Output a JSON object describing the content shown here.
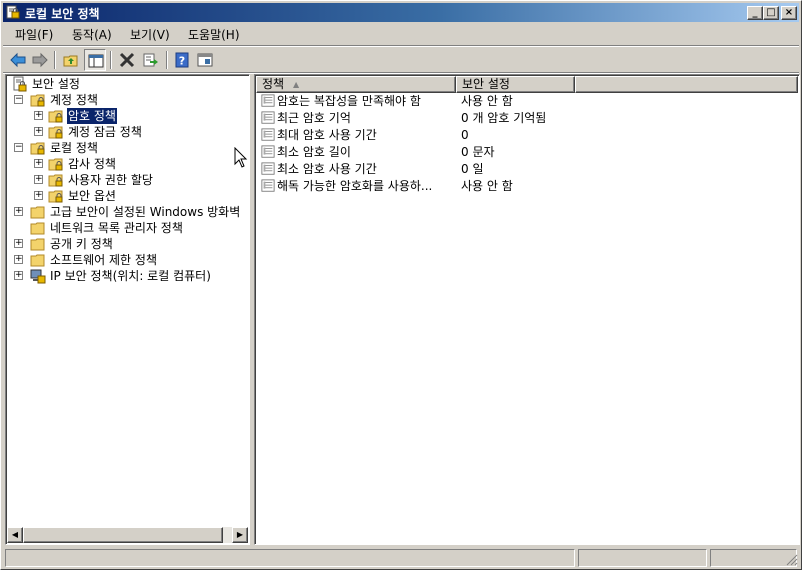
{
  "window": {
    "title": "로컬 보안 정책",
    "buttons": {
      "minimize": "_",
      "maximize": "□",
      "close": "×"
    }
  },
  "menu": [
    "파일(F)",
    "동작(A)",
    "보기(V)",
    "도움말(H)"
  ],
  "toolbar": [
    {
      "name": "back-button",
      "icon": "arrow-left-icon"
    },
    {
      "name": "forward-button",
      "icon": "arrow-right-icon"
    },
    {
      "name": "up-button",
      "icon": "folder-up-icon"
    },
    {
      "name": "show-hide-tree-button",
      "icon": "console-tree-icon"
    },
    {
      "name": "delete-button",
      "icon": "x-icon"
    },
    {
      "name": "export-button",
      "icon": "export-list-icon"
    },
    {
      "name": "help-button",
      "icon": "help-icon"
    },
    {
      "name": "properties-button",
      "icon": "properties-icon"
    }
  ],
  "tree": [
    {
      "label": "보안 설정",
      "expander": "",
      "icon": "security-settings-icon",
      "selected": false
    },
    {
      "label": "계정 정책",
      "expander": "−",
      "icon": "folder-lock-icon",
      "selected": false
    },
    {
      "label": "암호 정책",
      "expander": "+",
      "icon": "folder-lock-icon",
      "selected": true
    },
    {
      "label": "계정 잠금 정책",
      "expander": "+",
      "icon": "folder-lock-icon",
      "selected": false
    },
    {
      "label": "로컬 정책",
      "expander": "−",
      "icon": "folder-lock-icon",
      "selected": false
    },
    {
      "label": "감사 정책",
      "expander": "+",
      "icon": "folder-lock-icon",
      "selected": false
    },
    {
      "label": "사용자 권한 할당",
      "expander": "+",
      "icon": "folder-lock-icon",
      "selected": false
    },
    {
      "label": "보안 옵션",
      "expander": "+",
      "icon": "folder-lock-icon",
      "selected": false
    },
    {
      "label": "고급 보안이 설정된 Windows 방화벽",
      "expander": "+",
      "icon": "folder-icon",
      "selected": false
    },
    {
      "label": "네트워크 목록 관리자 정책",
      "expander": "",
      "icon": "folder-icon",
      "selected": false
    },
    {
      "label": "공개 키 정책",
      "expander": "+",
      "icon": "folder-icon",
      "selected": false
    },
    {
      "label": "소프트웨어 제한 정책",
      "expander": "+",
      "icon": "folder-icon",
      "selected": false
    },
    {
      "label": "IP 보안 정책(위치: 로컬 컴퓨터)",
      "expander": "+",
      "icon": "ip-security-icon",
      "selected": false
    }
  ],
  "list": {
    "columns": [
      "정책",
      "보안 설정"
    ],
    "sort_indicator": "▲",
    "rows": [
      {
        "policy": "암호는 복잡성을 만족해야 함",
        "setting": "사용 안 함"
      },
      {
        "policy": "최근 암호 기억",
        "setting": "0 개 암호 기억됨"
      },
      {
        "policy": "최대 암호 사용 기간",
        "setting": "0"
      },
      {
        "policy": "최소 암호 길이",
        "setting": "0 문자"
      },
      {
        "policy": "최소 암호 사용 기간",
        "setting": "0 일"
      },
      {
        "policy": "해독 가능한 암호화를 사용하...",
        "setting": "사용 안 함"
      }
    ]
  },
  "scrollbar": {
    "left": "◀",
    "right": "▶"
  },
  "colors": {
    "title_start": "#0a246a",
    "title_end": "#a6caf0",
    "selection": "#0a246a",
    "face": "#d4d0c8"
  }
}
